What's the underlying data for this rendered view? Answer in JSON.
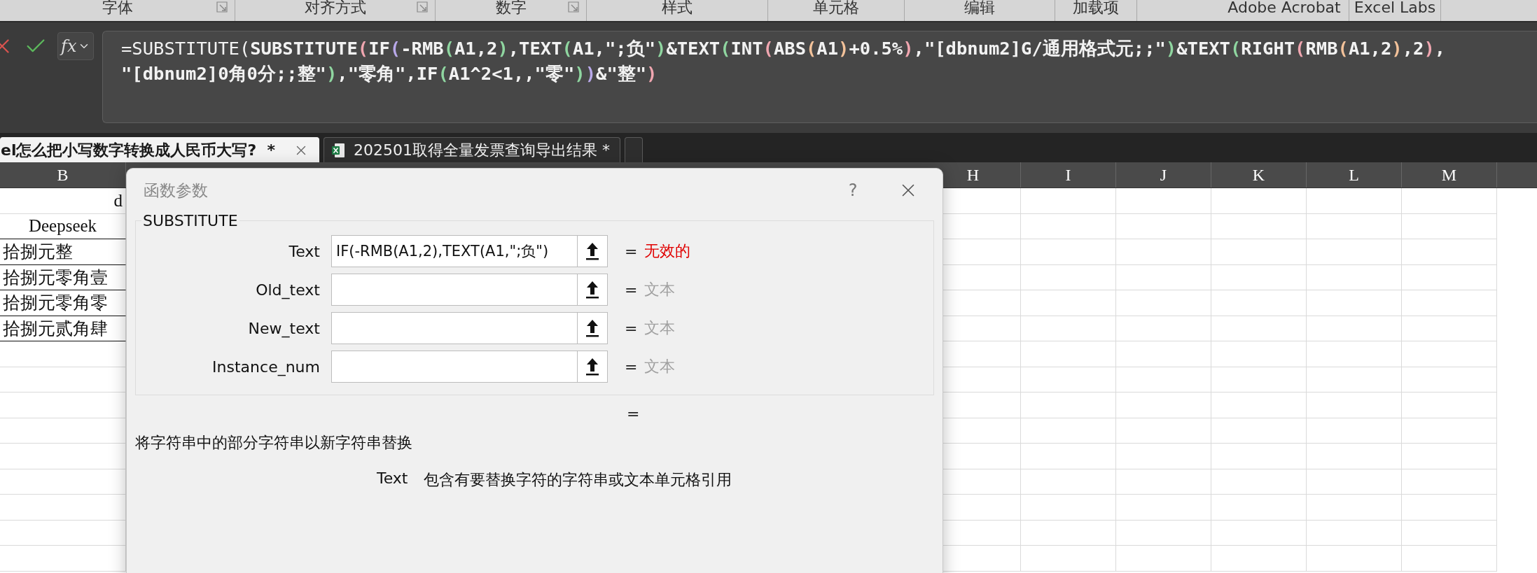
{
  "ribbon_groups": [
    {
      "label": "字体",
      "launcher": true
    },
    {
      "label": "对齐方式",
      "launcher": true
    },
    {
      "label": "数字",
      "launcher": true
    },
    {
      "label": "样式",
      "launcher": false
    },
    {
      "label": "单元格",
      "launcher": false
    },
    {
      "label": "编辑",
      "launcher": false
    },
    {
      "label": "加载项",
      "launcher": false
    },
    {
      "label": "Adobe Acrobat",
      "launcher": false
    },
    {
      "label": "Excel Labs",
      "launcher": false
    }
  ],
  "formula_bar": {
    "function_button": "fx",
    "lines": [
      [
        {
          "text": "=SUBSTITUTE(",
          "color": "#f2f2f2",
          "bold": false
        },
        {
          "text": "SUBSTITUTE",
          "color": "#f2f2f2",
          "bold": true
        },
        {
          "text": "(",
          "color": "#f0a6b0",
          "bold": true
        },
        {
          "text": "IF",
          "color": "#f2f2f2",
          "bold": true
        },
        {
          "text": "(",
          "color": "#b9a9ea",
          "bold": true
        },
        {
          "text": "-RMB",
          "color": "#f2f2f2",
          "bold": true
        },
        {
          "text": "(",
          "color": "#8fd6a0",
          "bold": true
        },
        {
          "text": "A1,2",
          "color": "#f2f2f2",
          "bold": true
        },
        {
          "text": ")",
          "color": "#8fd6a0",
          "bold": true
        },
        {
          "text": ",TEXT",
          "color": "#f2f2f2",
          "bold": true
        },
        {
          "text": "(",
          "color": "#8fd6a0",
          "bold": true
        },
        {
          "text": "A1,\";负\"",
          "color": "#f2f2f2",
          "bold": true
        },
        {
          "text": ")",
          "color": "#8fd6a0",
          "bold": true
        },
        {
          "text": "&TEXT",
          "color": "#f2f2f2",
          "bold": true
        },
        {
          "text": "(",
          "color": "#8fd6a0",
          "bold": true
        },
        {
          "text": "INT",
          "color": "#f2f2f2",
          "bold": true
        },
        {
          "text": "(",
          "color": "#f0a6b0",
          "bold": true
        },
        {
          "text": "ABS",
          "color": "#f2f2f2",
          "bold": true
        },
        {
          "text": "(",
          "color": "#f3c29a",
          "bold": true
        },
        {
          "text": "A1",
          "color": "#f2f2f2",
          "bold": true
        },
        {
          "text": ")",
          "color": "#f3c29a",
          "bold": true
        },
        {
          "text": "+0.5%",
          "color": "#f2f2f2",
          "bold": true
        },
        {
          "text": ")",
          "color": "#f0a6b0",
          "bold": true
        },
        {
          "text": ",\"[dbnum2]G/通用格式元;;\"",
          "color": "#f2f2f2",
          "bold": true
        },
        {
          "text": ")",
          "color": "#8fd6a0",
          "bold": true
        },
        {
          "text": "&TEXT",
          "color": "#f2f2f2",
          "bold": true
        },
        {
          "text": "(",
          "color": "#8fd6a0",
          "bold": true
        },
        {
          "text": "RIGHT",
          "color": "#f2f2f2",
          "bold": true
        },
        {
          "text": "(",
          "color": "#f0a6b0",
          "bold": true
        },
        {
          "text": "RMB",
          "color": "#f2f2f2",
          "bold": true
        },
        {
          "text": "(",
          "color": "#f3c29a",
          "bold": true
        },
        {
          "text": "A1,2",
          "color": "#f2f2f2",
          "bold": true
        },
        {
          "text": ")",
          "color": "#f3c29a",
          "bold": true
        },
        {
          "text": ",2",
          "color": "#f2f2f2",
          "bold": true
        },
        {
          "text": ")",
          "color": "#f0a6b0",
          "bold": true
        },
        {
          "text": ",",
          "color": "#f2f2f2",
          "bold": true
        }
      ],
      [
        {
          "text": "\"[dbnum2]0角0分;;整\"",
          "color": "#f2f2f2",
          "bold": true
        },
        {
          "text": ")",
          "color": "#8fd6a0",
          "bold": true
        },
        {
          "text": ",\"零角\",IF",
          "color": "#f2f2f2",
          "bold": true
        },
        {
          "text": "(",
          "color": "#8fd6a0",
          "bold": true
        },
        {
          "text": "A1^2<1,,\"零\"",
          "color": "#f2f2f2",
          "bold": true
        },
        {
          "text": ")",
          "color": "#8fd6a0",
          "bold": true
        },
        {
          "text": ")",
          "color": "#b9a9ea",
          "bold": true
        },
        {
          "text": "&\"整\"",
          "color": "#f2f2f2",
          "bold": true
        },
        {
          "text": ")",
          "color": "#f0a6b0",
          "bold": true
        }
      ]
    ]
  },
  "document_tabs": [
    {
      "label": "el怎么把小写数字转换成人民币大写?  *",
      "selected": true
    },
    {
      "label": "202501取得全量发票查询导出结果 *",
      "selected": false
    },
    {
      "selected": false
    }
  ],
  "columns": [
    "B",
    "H",
    "I",
    "J",
    "K",
    "L",
    "M"
  ],
  "rows": [
    {
      "text": "d",
      "kind": "title"
    },
    {
      "text": "Deepseek",
      "kind": "header"
    },
    {
      "text": "拾捌元整",
      "kind": "value"
    },
    {
      "text": "拾捌元零角壹",
      "kind": "value"
    },
    {
      "text": "拾捌元零角零",
      "kind": "value"
    },
    {
      "text": "拾捌元贰角肆",
      "kind": "value"
    }
  ],
  "dialog": {
    "title": "函数参数",
    "help": "?",
    "function": "SUBSTITUTE",
    "args": [
      {
        "name": "Text",
        "value": "IF(-RMB(A1,2),TEXT(A1,\";负\")",
        "equals": "=",
        "result": "无效的",
        "kind": "error"
      },
      {
        "name": "Old_text",
        "equals": "=",
        "result": "文本",
        "kind": "hint"
      },
      {
        "name": "New_text",
        "equals": "=",
        "result": "文本",
        "kind": "hint"
      },
      {
        "name": "Instance_num",
        "equals": "=",
        "result": "文本",
        "kind": "hint"
      }
    ],
    "result_equals": "=",
    "description": "将字符串中的部分字符串以新字符串替换",
    "arg_help": {
      "name": "Text",
      "text": "包含有要替换字符的字符串或文本单元格引用"
    }
  }
}
